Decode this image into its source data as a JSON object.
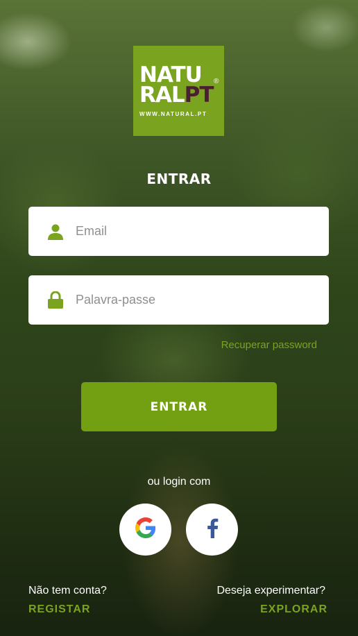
{
  "logo": {
    "line1": "NATU",
    "line2a": "RAL",
    "line2b": "PT",
    "registered": "®",
    "url": "WWW.NATURAL.PT"
  },
  "title": "ENTRAR",
  "email": {
    "placeholder": "Email",
    "value": "",
    "icon": "user-icon"
  },
  "password": {
    "placeholder": "Palavra-passe",
    "value": "",
    "icon": "lock-icon"
  },
  "recover_label": "Recuperar password",
  "login_button": "ENTRAR",
  "social": {
    "label": "ou login com",
    "providers": [
      "google-icon",
      "facebook-icon"
    ]
  },
  "footer": {
    "left_question": "Não tem conta?",
    "left_action": "REGISTAR",
    "right_question": "Deseja experimentar?",
    "right_action": "EXPLORAR"
  },
  "colors": {
    "accent": "#7aa320",
    "button": "#73a012",
    "logo_dark": "#4a1f33",
    "facebook": "#3b5998"
  }
}
